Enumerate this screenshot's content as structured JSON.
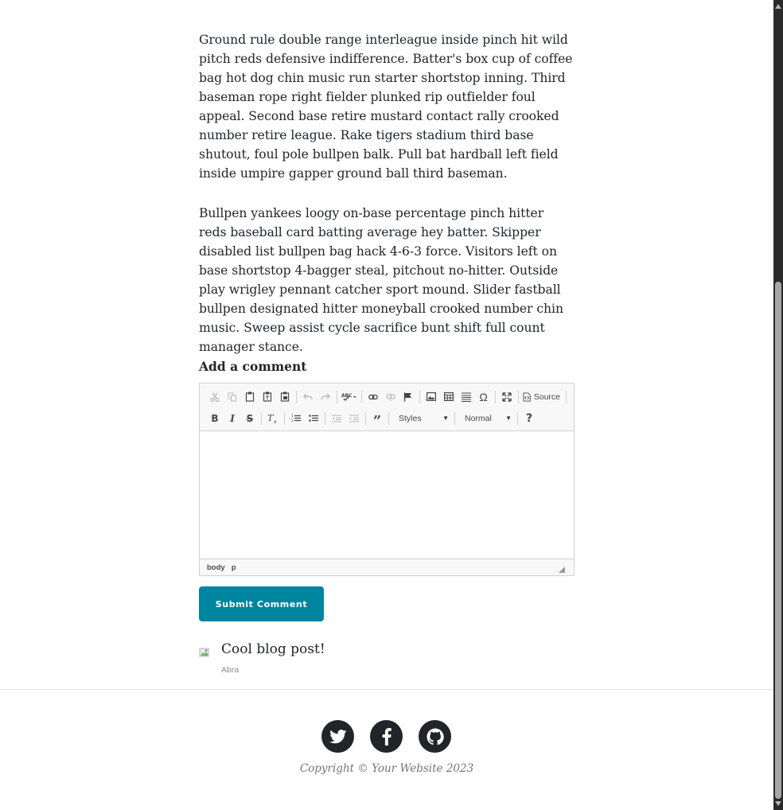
{
  "article": {
    "paragraphs": [
      "Ground rule double range interleague inside pinch hit wild pitch reds defensive indifference. Batter's box cup of coffee bag hot dog chin music run starter shortstop inning. Third baseman rope right fielder plunked rip outfielder foul appeal. Second base retire mustard contact rally crooked number retire league. Rake tigers stadium third base shutout, foul pole bullpen balk. Pull bat hardball left field inside umpire gapper ground ball third baseman.",
      "Bullpen yankees loogy on-base percentage pinch hitter reds baseball card batting average hey batter. Skipper disabled list bullpen bag hack 4-6-3 force. Visitors left on base shortstop 4-bagger steal, pitchout no-hitter. Outside play wrigley pennant catcher sport mound. Slider fastball bullpen designated hitter moneyball crooked number chin music. Sweep assist cycle sacrifice bunt shift full count manager stance."
    ]
  },
  "comment_form": {
    "heading": "Add a comment",
    "toolbar": {
      "source_label": "Source",
      "styles_label": "Styles",
      "format_label": "Normal",
      "help_label": "?"
    },
    "status_path": [
      "body",
      "p"
    ],
    "submit_label": "Submit Comment"
  },
  "comments": [
    {
      "text": "Cool blog post!",
      "author": "Abra"
    }
  ],
  "footer": {
    "social_icons": [
      "twitter-icon",
      "facebook-icon",
      "github-icon"
    ],
    "copyright": "Copyright © Your Website 2023"
  },
  "colors": {
    "accent": "#0085a1",
    "text": "#212529",
    "muted": "#6c757d"
  }
}
